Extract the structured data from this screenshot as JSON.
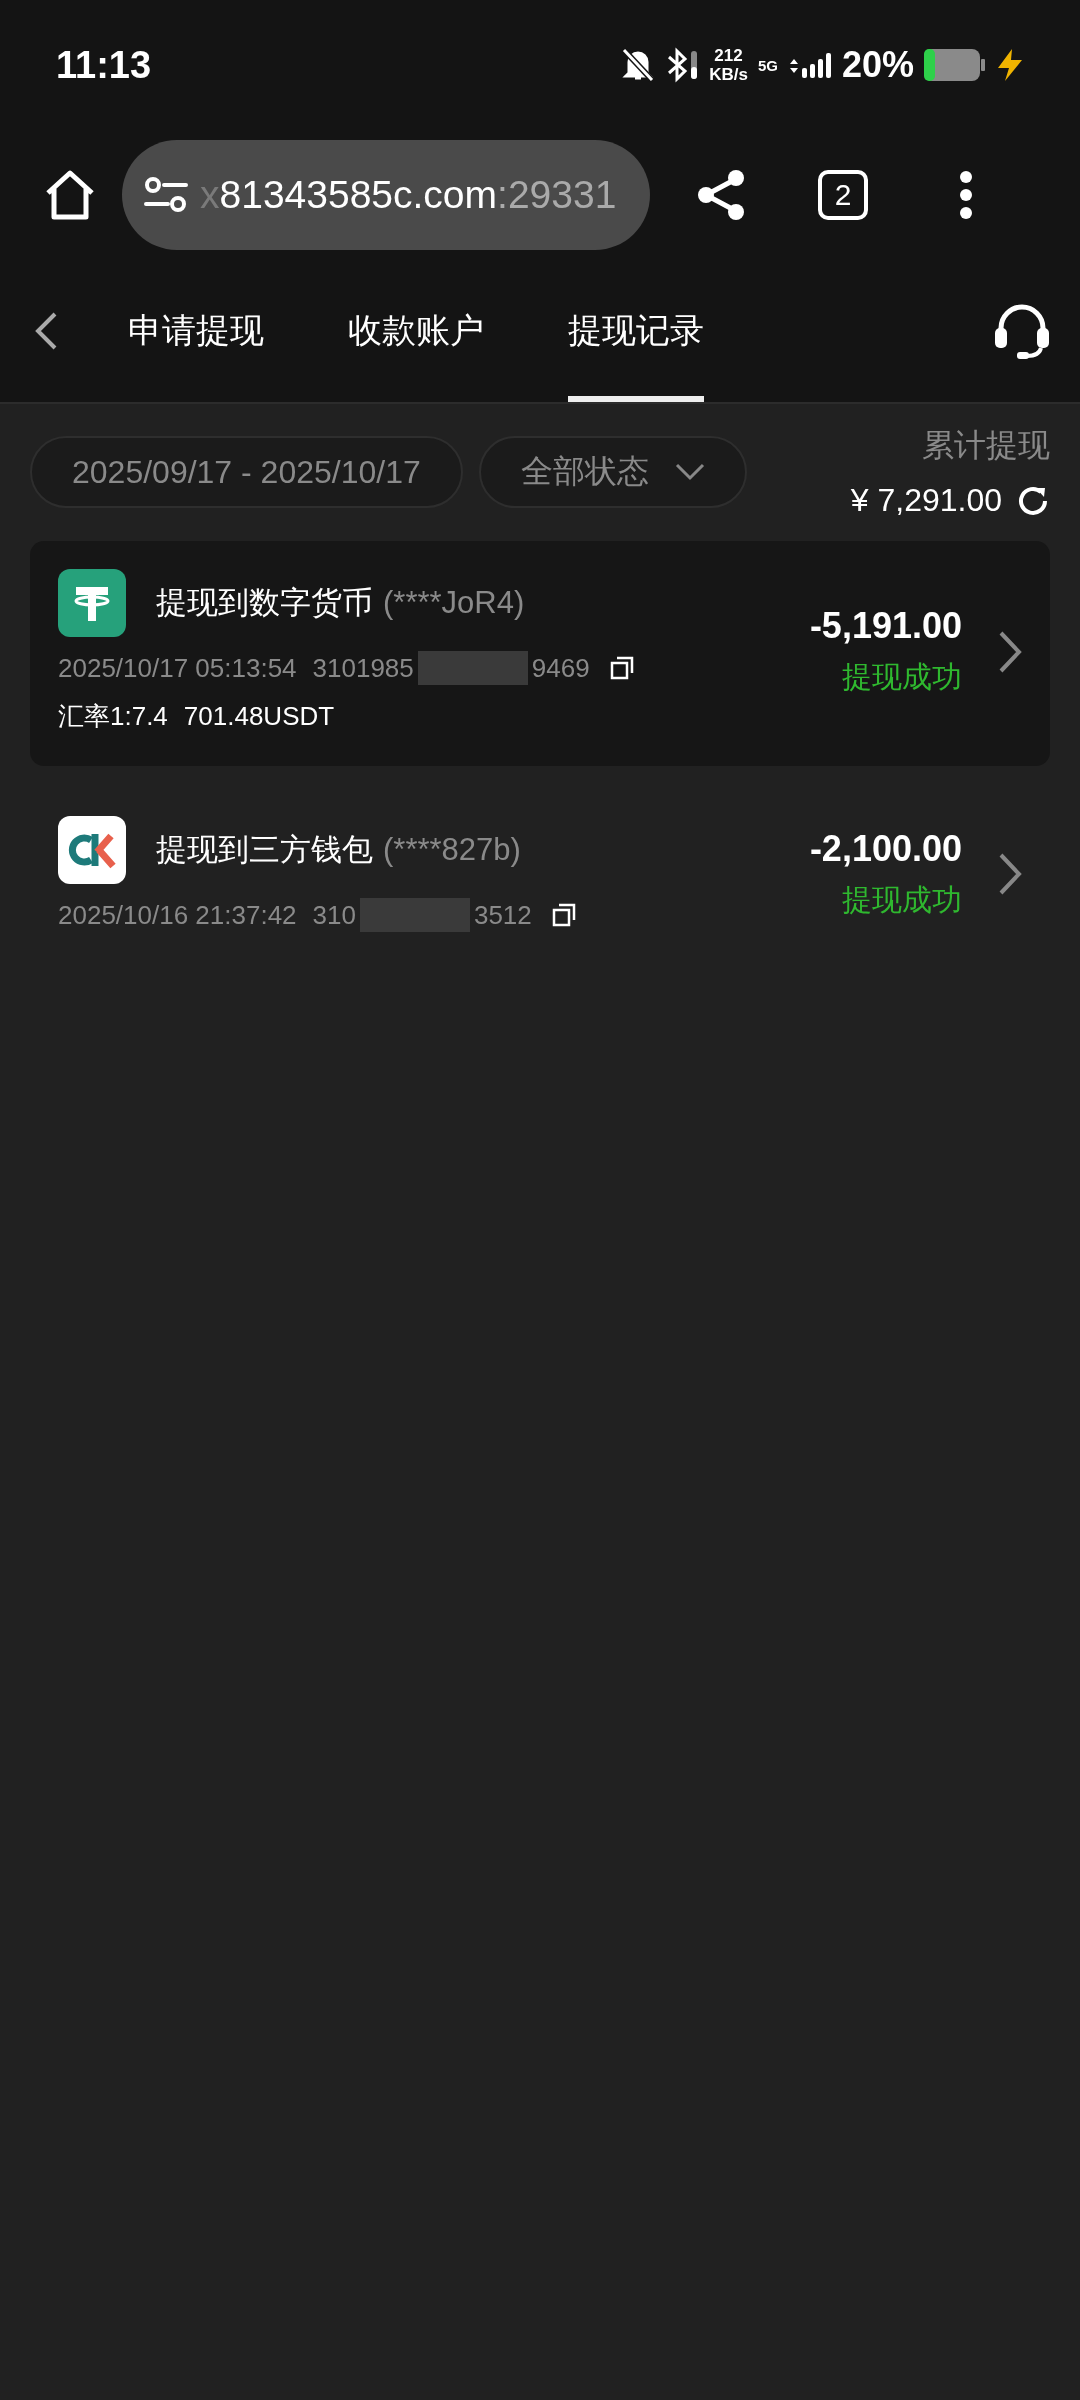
{
  "status_bar": {
    "time": "11:13",
    "net_speed": "212",
    "net_unit": "KB/s",
    "network": "5G",
    "battery": "20%"
  },
  "browser": {
    "url_faded": "x",
    "url_host": "81343585c.com",
    "url_port": ":29331",
    "tab_count": "2"
  },
  "nav": {
    "tabs": [
      {
        "label": "申请提现",
        "selected": false
      },
      {
        "label": "收款账户",
        "selected": false
      },
      {
        "label": "提现记录",
        "selected": true
      }
    ]
  },
  "filters": {
    "date_range": "2025/09/17 - 2025/10/17",
    "status": "全部状态"
  },
  "summary": {
    "label": "累计提现",
    "amount": "¥ 7,291.00"
  },
  "records": [
    {
      "kind": "crypto",
      "title": "提现到数字货币",
      "account": "(****JoR4)",
      "time": "2025/10/17 05:13:54",
      "order_start": "3101985",
      "order_end": "9469",
      "rate_label": "汇率1:7.4",
      "converted": "701.48USDT",
      "amount": "-5,191.00",
      "status": "提现成功",
      "highlighted": true
    },
    {
      "kind": "wallet",
      "title": "提现到三方钱包",
      "account": "(****827b)",
      "time": "2025/10/16 21:37:42",
      "order_start": "310",
      "order_end": "3512",
      "amount": "-2,100.00",
      "status": "提现成功",
      "highlighted": false
    }
  ]
}
